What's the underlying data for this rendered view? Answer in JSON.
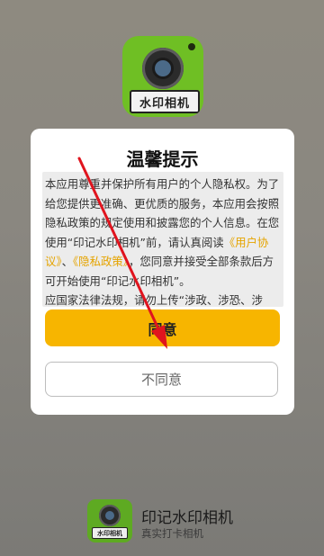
{
  "app_icon": {
    "plate_text": "水印相机"
  },
  "dialog": {
    "title": "温馨提示",
    "body_part1": "本应用尊重并保护所有用户的个人隐私权。为了给您提供更准确、更优质的服务，本应用会按照隐私政策的规定使用和披露您的个人信息。在您使用“印记水印相机”前，请认真阅读",
    "link_user_agreement": "《用户协议》",
    "separator": "、",
    "link_privacy_policy": "《隐私政策》",
    "body_part2": "，您同意并接受全部条款后方可开始使用“印记水印相机”。",
    "body_part3": "应国家法律法规，请勿上传“涉政、涉恐、涉",
    "agree_label": "同意",
    "disagree_label": "不同意"
  },
  "branding": {
    "icon_plate_text": "水印相机",
    "app_name": "印记水印相机",
    "slogan": "真实打卡相机"
  },
  "colors": {
    "accent": "#f7b500",
    "link": "#e5a400",
    "arrow": "#e0141e",
    "icon_green": "#6fbf24"
  },
  "icons": [
    "camera-app-icon",
    "red-arrow-annotation"
  ]
}
